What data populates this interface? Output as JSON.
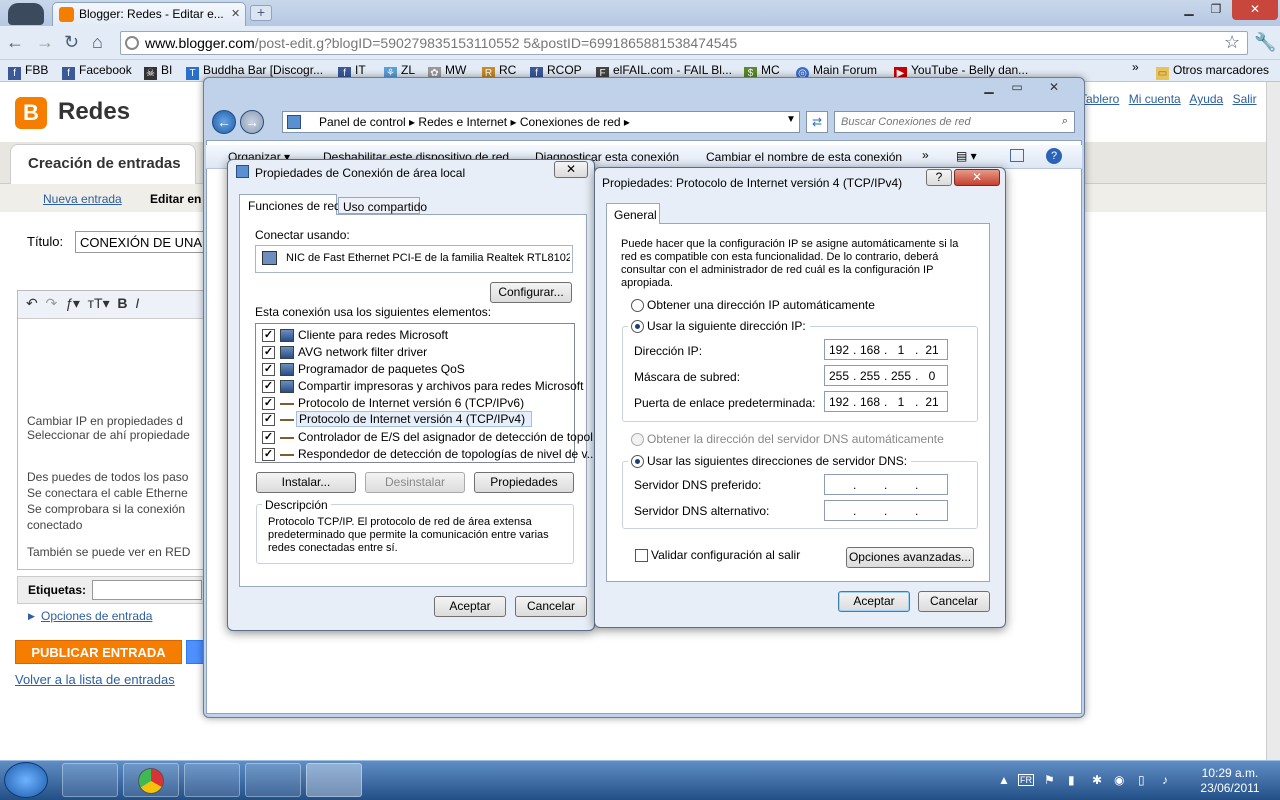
{
  "browser": {
    "tab_title": "Blogger: Redes - Editar e...",
    "url_host": "www.blogger.com",
    "url_path": "/post-edit.g?blogID=590279835153110552 5&postID=6991865881538474545",
    "bookmarks": [
      "FBB",
      "Facebook",
      "BI",
      "Buddha Bar [Discogr...",
      "IT",
      "ZL",
      "MW",
      "RC",
      "RCOP",
      "elFAIL.com - FAIL Bl...",
      "MC",
      "Main Forum",
      "YouTube - Belly dan...",
      "Otros marcadores"
    ],
    "more": "»"
  },
  "blogger": {
    "logo": "B",
    "blog_name": "Redes",
    "top_links": [
      "Tablero",
      "Mi cuenta",
      "Ayuda",
      "Salir"
    ],
    "tab_creation": "Creación de entradas",
    "new_post": "Nueva entrada",
    "edit_entries": "Editar en",
    "title_label": "Título:",
    "title_value": "CONEXIÓN DE UNA",
    "body_lines": [
      "Cambiar IP en propiedades d",
      "Seleccionar de ahí propiedade",
      "Des puedes de todos los paso",
      "Se conectara el cable Etherne",
      "Se comprobara si la conexión",
      "conectado",
      "También se puede ver en RED"
    ],
    "labels_label": "Etiquetas:",
    "post_options": "Opciones de entrada",
    "publish": "PUBLICAR ENTRADA",
    "back_to_list": "Volver a la lista de entradas"
  },
  "explorer": {
    "crumbs": "Panel de control  ▸  Redes e Internet  ▸  Conexiones de red  ▸",
    "search_placeholder": "Buscar Conexiones de red",
    "commands": [
      "Organizar ▾",
      "Deshabilitar este dispositivo de red",
      "Diagnosticar esta conexión",
      "Cambiar el nombre de esta conexión",
      "»"
    ]
  },
  "lan": {
    "title": "Propiedades de Conexión de área local",
    "tab_network": "Funciones de red",
    "tab_sharing": "Uso compartido",
    "connect_using": "Conectar usando:",
    "adapter": "NIC de Fast Ethernet PCI-E de la familia Realtek RTL8102",
    "configure": "Configurar...",
    "items_label": "Esta conexión usa los siguientes elementos:",
    "items": [
      "Cliente para redes Microsoft",
      "AVG network filter driver",
      "Programador de paquetes QoS",
      "Compartir impresoras y archivos para redes Microsoft",
      "Protocolo de Internet versión 6 (TCP/IPv6)",
      "Protocolo de Internet versión 4 (TCP/IPv4)",
      "Controlador de E/S del asignador de detección de topol...",
      "Respondedor de detección de topologías de nivel de v..."
    ],
    "install": "Instalar...",
    "uninstall": "Desinstalar",
    "properties": "Propiedades",
    "desc_title": "Descripción",
    "desc_text": "Protocolo TCP/IP. El protocolo de red de área extensa predeterminado que permite la comunicación entre varias redes conectadas entre sí.",
    "ok": "Aceptar",
    "cancel": "Cancelar"
  },
  "ipv4": {
    "title": "Propiedades: Protocolo de Internet versión 4 (TCP/IPv4)",
    "help": "?",
    "tab_general": "General",
    "intro": "Puede hacer que la configuración IP se asigne automáticamente si la red es compatible con esta funcionalidad. De lo contrario, deberá consultar con el administrador de red cuál es la configuración IP apropiada.",
    "auto_ip": "Obtener una dirección IP automáticamente",
    "use_ip": "Usar la siguiente dirección IP:",
    "ip_label": "Dirección IP:",
    "ip": [
      "192",
      "168",
      "1",
      "21"
    ],
    "mask_label": "Máscara de subred:",
    "mask": [
      "255",
      "255",
      "255",
      "0"
    ],
    "gw_label": "Puerta de enlace predeterminada:",
    "gw": [
      "192",
      "168",
      "1",
      "21"
    ],
    "auto_dns": "Obtener la dirección del servidor DNS automáticamente",
    "use_dns": "Usar las siguientes direcciones de servidor DNS:",
    "dns1_label": "Servidor DNS preferido:",
    "dns2_label": "Servidor DNS alternativo:",
    "validate": "Validar configuración al salir",
    "advanced": "Opciones avanzadas...",
    "ok": "Aceptar",
    "cancel": "Cancelar"
  },
  "taskbar": {
    "time": "10:29 a.m.",
    "date": "23/06/2011",
    "lang": "FR"
  }
}
